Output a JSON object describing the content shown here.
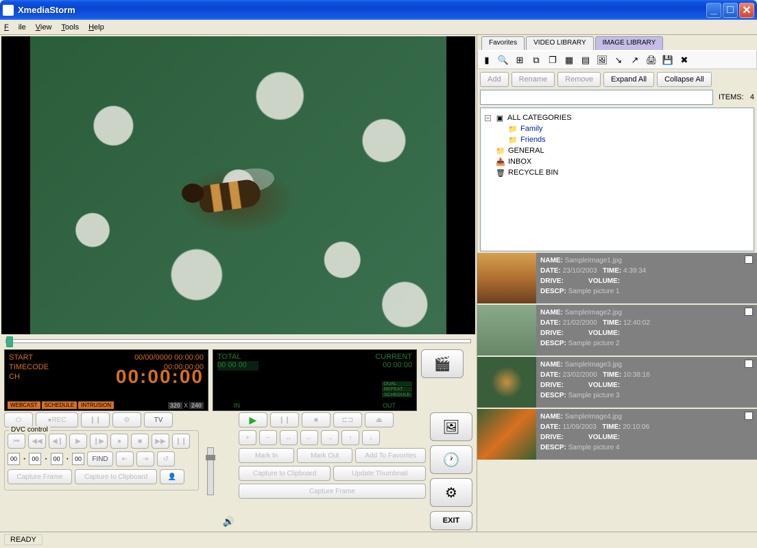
{
  "window": {
    "title": "XmediaStorm"
  },
  "menu": {
    "file": "File",
    "view": "View",
    "tools": "Tools",
    "help": "Help"
  },
  "lcd1": {
    "start_label": "START",
    "start_val": "00/00/0000  00:00:00",
    "tc_label": "TIMECODE",
    "tc_val": "00:00:00:00",
    "ch_label": "CH",
    "ch_val": "00:00:00",
    "badges": [
      "WEBCAST",
      "SCHEDULE",
      "INTRUSION"
    ],
    "res_w": "320",
    "res_x": "X",
    "res_h": "240"
  },
  "lcd2": {
    "total_label": "TOTAL",
    "current_label": "CURRENT",
    "total_val": "00 00 00",
    "current_val": "00:00:00",
    "flags": [
      "DUAL",
      "REPEAT",
      "SCHEDULE"
    ],
    "in_label": "IN",
    "out_label": "OUT"
  },
  "rec_row": {
    "rec": "REC",
    "tv": "TV"
  },
  "dvc": {
    "legend": "DVC control",
    "tc": [
      "00",
      "00",
      "00",
      "00"
    ],
    "find": "FIND",
    "capture_frame": "Capture Frame",
    "capture_clip": "Capture to Clipboard"
  },
  "editbtns": {
    "mark_in": "Mark In",
    "mark_out": "Mark Out",
    "add_fav": "Add To Favorites",
    "cap_clip": "Capture to Clipboard",
    "upd_thumb": "Update Thumbnail",
    "cap_frame": "Capture Frame"
  },
  "exit": "EXIT",
  "tabs": {
    "fav": "Favorites",
    "vid": "VIDEO LIBRARY",
    "img": "IMAGE LIBRARY"
  },
  "actions": {
    "add": "Add",
    "rename": "Rename",
    "remove": "Remove",
    "expand": "Expand All",
    "collapse": "Collapse All"
  },
  "items_label": "ITEMS:",
  "items_count": "4",
  "tree": {
    "all": "ALL CATEGORIES",
    "family": "Family",
    "friends": "Friends",
    "general": "GENERAL",
    "inbox": "INBOX",
    "recycle": "RECYCLE BIN"
  },
  "meta_labels": {
    "name": "NAME:",
    "date": "DATE:",
    "time": "TIME:",
    "drive": "DRIVE:",
    "volume": "VOLUME:",
    "descp": "DESCP:"
  },
  "thumbs": [
    {
      "name": "SampleImage1.jpg",
      "date": "23/10/2003",
      "time": "4:39:34",
      "descp": "Sample picture 1"
    },
    {
      "name": "SampleImage2.jpg",
      "date": "21/02/2000",
      "time": "12:40:02",
      "descp": "Sample picture 2"
    },
    {
      "name": "SampleImage3.jpg",
      "date": "23/02/2000",
      "time": "10:38:16",
      "descp": "Sample picture 3"
    },
    {
      "name": "SampleImage4.jpg",
      "date": "11/09/2003",
      "time": "20:10:06",
      "descp": "Sample picture 4"
    }
  ],
  "status": "READY"
}
